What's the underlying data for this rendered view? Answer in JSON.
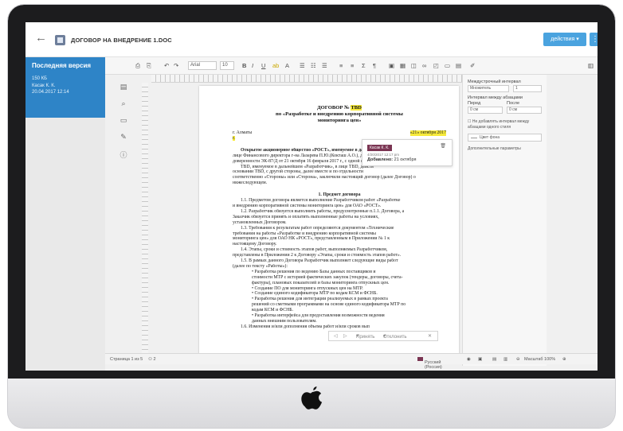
{
  "header": {
    "back_icon": "back-arrow-icon",
    "title": "ДОГОВОР НА ВНЕДРЕНИЕ 1.DOC",
    "actions_label": "действия",
    "more_label": "⋮",
    "accent": "#4aa3df"
  },
  "version": {
    "title": "Последняя версия",
    "size": "150 КБ",
    "author": "Касак К. К.",
    "date": "20.04.2017 12:14",
    "color": "#2e84c7"
  },
  "toolbar": {
    "font_name": "Arial",
    "font_size": "10",
    "bold": "B",
    "italic": "I",
    "underline": "U"
  },
  "document": {
    "heading_1": "ДОГОВОР №",
    "heading_1_num": "TBD",
    "heading_2": "по «Разработке и внедрению корпоративной системы",
    "heading_3": "мониторинга цен»",
    "city": "г. Алматы",
    "date": "«21» октября 2017",
    "date_suffix": "г.",
    "lines": [
      "Открытое акционерное общество «РОСТ», именуемое в дальнейшем «За",
      "лице Финансового директора г-на Лазарева П.Ю.(Кокташ А.О.), действующего на",
      "доверенности ЭК-87/Д от 21 октября 16 февраля 2017 г., с одной стороны, и",
      "TBD, именуемое в дальнейшем «Разработчик», в лице TBD, действ",
      "основании TBD, с другой стороны, далее вместе и по отдельности",
      "соответственно «Стороны» или «Сторона», заключили настоящий договор (далее Договор) о",
      "нижеследующем."
    ],
    "section_title": "1.       Предмет договора",
    "clauses": [
      "1.1.    Предметом договора является выполнение Разработчиком работ «Разработке",
      "и внедрению корпоративной системы мониторинга цен» для ОАО «РОСТ».",
      "1.2.    Разработчик обязуется выполнить работы, предусмотренные п.1.1. Договора, а",
      "Заказчик обязуется принять и оплатить выполненные работы на условиях,",
      "установленных Договором.",
      "1.3.    Требования к результатам работ определяются документом «Технические",
      "требования на работы «Разработке и внедрению корпоративной системы",
      "мониторинга цен» для ОАО НК «РОСТ», представленным в Приложении № 1 к",
      "настоящему Договору.",
      "1.4.    Этапы, сроки и стоимость этапов работ, выполняемых Разработчиком,",
      "представлены в Приложении 2 к Договору «Этапы, сроки и стоимость этапов работ».",
      "1.5.    В рамках данного Договора Разработчик выполняет следующие виды работ",
      "(далее по тексту «Работы»):"
    ],
    "bullets": [
      "•        Разработка решения по ведению Базы данных поставщиков и",
      "стоимости МТР с историей фактических закупок (тендеры, договоры, счета-",
      "фактуры), плановых показателей и базы мониторинга отпускных цен.",
      "•        Создание ПО для мониторинга отпускных цен на МТР.",
      "•        Создание единого кодификатора МТР по кодам КСМ и ФСНБ.",
      "•        Разработка решения для интеграции реализуемых в рамках проекта",
      "решений со сметными программами на основе единого кодификатора МТР по",
      "кодам КСМ и ФСНБ.",
      "•        Разработка интерфейса для предоставления возможности ведения",
      "данных внешним пользователям.",
      "1.6.    Изменения и/или дополнения объема работ и/или сроков вып"
    ]
  },
  "comment": {
    "author": "Касак К. К.",
    "date": "4/20/2017 12:17 pm",
    "label": "Добавлено:",
    "value": "21 октября",
    "author_color": "#7a3452"
  },
  "review": {
    "accept": "Принять",
    "reject": "Отклонить",
    "close": "✕"
  },
  "right_panel": {
    "line_spacing_label": "Междустрочный интервал",
    "line_spacing_value": "Множитель",
    "line_spacing_num": "1",
    "para_spacing_label": "Интервал между абзацами",
    "before_label": "Перед",
    "after_label": "После",
    "before_value": "0 см",
    "after_value": "0 см",
    "checkbox_label": "Не добавлять интервал между абзацами одного стиля",
    "bg_color_label": "Цвет фона",
    "advanced_label": "Дополнительные параметры"
  },
  "status": {
    "page": "Страница 1 из 5",
    "language": "Русский (Россия)",
    "zoom": "Масштаб 100%"
  },
  "icons": {
    "apple_logo": "apple-logo-icon"
  }
}
